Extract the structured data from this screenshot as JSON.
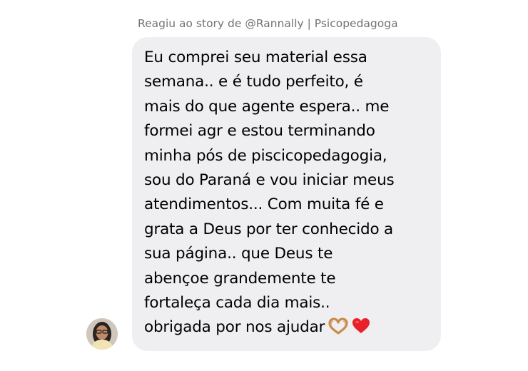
{
  "story_reply": {
    "header": "Reagiu ao story de @Rannally | Psicopedagoga"
  },
  "message": {
    "text": "Eu comprei seu material essa\nsemana.. e é tudo perfeito, é\nmais do que agente espera.. me\nformei agr e estou terminando\nminha pós de piscicopedagogia,\nsou do Paraná e vou iniciar meus\natendimentos... Com muita fé e\ngrata a Deus por ter conhecido a\nsua página.. que Deus te\nabençoe grandemente te\nfortaleça cada dia mais..\nobrigada por nos ajudar",
    "emojis": [
      "heart-hands-icon",
      "red-heart-icon"
    ]
  },
  "sender": {
    "avatar_icon": "user-avatar"
  },
  "colors": {
    "bubble_background": "#efeff2",
    "header_text": "#737373",
    "message_text": "#000000",
    "heart": "#e8202a",
    "heart_hands": "#c98a4b"
  }
}
